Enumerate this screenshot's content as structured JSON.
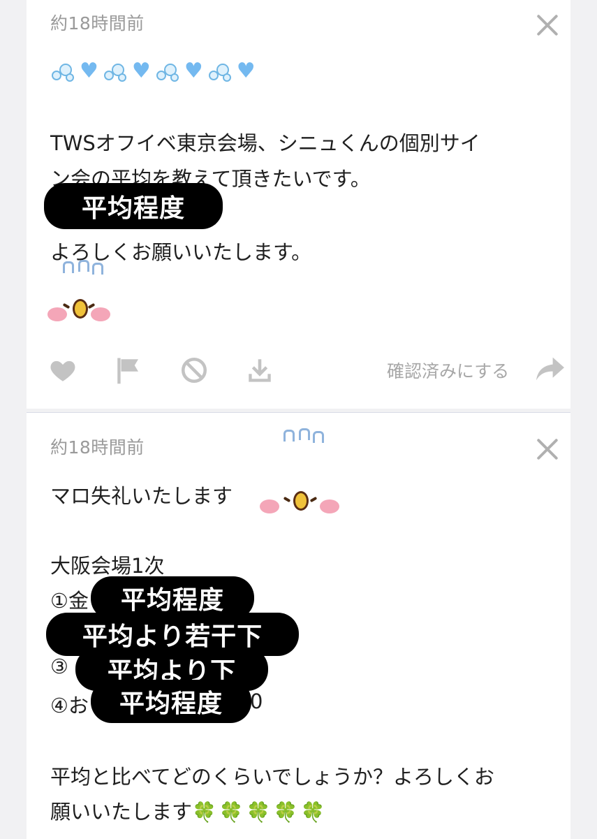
{
  "posts": [
    {
      "timestamp": "約18時間前",
      "lines": [
        "TWSオフイベ東京会場、シニュくんの個別サイ",
        "ン会の平均を教えて頂きたいです。",
        "。",
        "よろしくお願いいたします。"
      ],
      "overlay": "平均程度",
      "actions": {
        "like_icon": "heart-icon",
        "report_icon": "flag-icon",
        "block_icon": "block-icon",
        "download_icon": "download-icon",
        "confirm_label": "確認済みにする",
        "share_icon": "share-arrow-icon"
      }
    },
    {
      "timestamp": "約18時間前",
      "lines": [
        "マロ失礼いたします",
        "大阪会場1次",
        "①金",
        "③",
        "④お",
        "0",
        "平均と比べてどのくらいでしょうか？よろしくお",
        "願いいたします"
      ],
      "overlays": [
        "平均程度",
        "平均より若干下",
        "平均より下",
        "平均程度"
      ],
      "emoji_trailer": "🍀🍀🍀🍀🍀"
    }
  ],
  "colors": {
    "background": "#f1f1f3",
    "card": "#ffffff",
    "muted_text": "#9a9a9a",
    "overlay_bg": "#000000"
  }
}
